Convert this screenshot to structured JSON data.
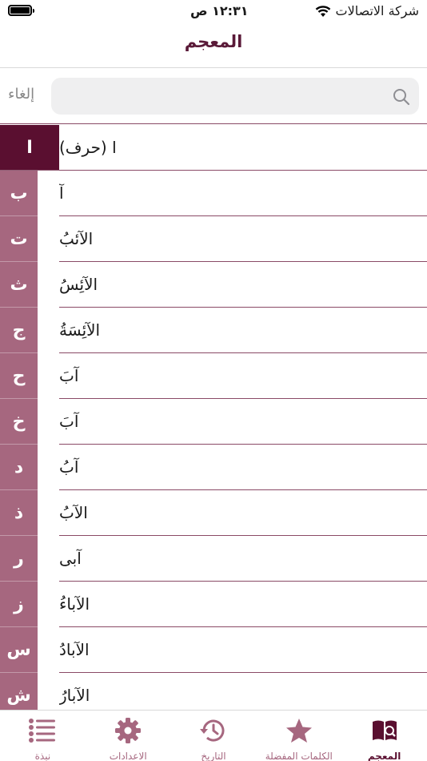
{
  "status_bar": {
    "time": "١٢:٣١ ص",
    "carrier": "شركة الاتصالات"
  },
  "nav": {
    "title": "المعجم"
  },
  "search": {
    "placeholder": "",
    "cancel_label": "إلغاء"
  },
  "letters": [
    "ا",
    "ب",
    "ت",
    "ث",
    "ج",
    "ح",
    "خ",
    "د",
    "ذ",
    "ر",
    "ز",
    "س",
    "ش"
  ],
  "active_letter_index": 0,
  "words": [
    "ا (حرف)",
    "آ",
    "الآئبُ",
    "الآئِسُ",
    "الآئِسَةُ",
    "آبَ",
    "آبَ",
    "آبُ",
    "الآبُ",
    "آبى",
    "الآباءُ",
    "الآبادُ",
    "الآبارُ"
  ],
  "tabs": [
    {
      "label": "المعجم",
      "icon": "book-search-icon",
      "active": true
    },
    {
      "label": "الكلمات المفضلة",
      "icon": "star-icon",
      "active": false
    },
    {
      "label": "التاريخ",
      "icon": "history-icon",
      "active": false
    },
    {
      "label": "الاعدادات",
      "icon": "gear-icon",
      "active": false
    },
    {
      "label": "نبذة",
      "icon": "list-icon",
      "active": false
    }
  ],
  "colors": {
    "accent_dark": "#5a0f30",
    "accent": "#a6677f"
  }
}
